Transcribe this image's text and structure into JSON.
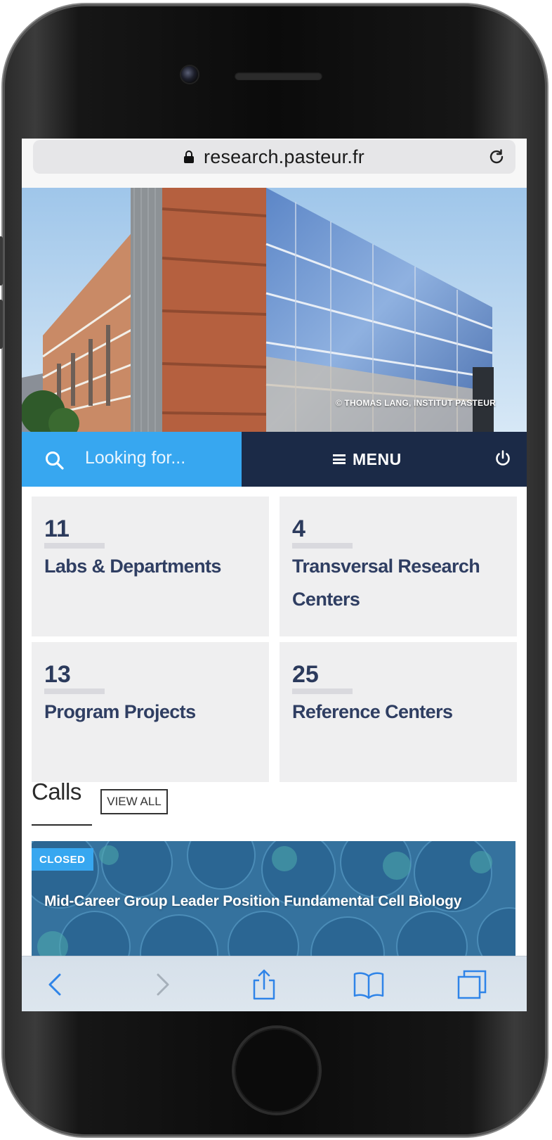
{
  "browser": {
    "url": "research.pasteur.fr"
  },
  "hero": {
    "credit": "© THOMAS LANG, INSTITUT PASTEUR"
  },
  "search": {
    "placeholder": "Looking for..."
  },
  "nav": {
    "menu_label": "MENU"
  },
  "stats": [
    {
      "count": "11",
      "label": "Labs & Departments"
    },
    {
      "count": "4",
      "label": "Transversal Research Centers"
    },
    {
      "count": "13",
      "label": "Program Projects"
    },
    {
      "count": "25",
      "label": "Reference Centers"
    }
  ],
  "calls": {
    "title": "Calls",
    "view_all_label": "VIEW ALL",
    "items": [
      {
        "status": "CLOSED",
        "title": "Mid-Career Group Leader Position Fundamental Cell Biology"
      }
    ]
  },
  "toolbar": {
    "icons": [
      "back-icon",
      "forward-icon",
      "share-icon",
      "bookmarks-icon",
      "tabs-icon"
    ]
  },
  "colors": {
    "search_blue": "#37a7f0",
    "menu_navy": "#1b2a47",
    "card_bg": "#efeff0",
    "card_text": "#2f3e62"
  }
}
